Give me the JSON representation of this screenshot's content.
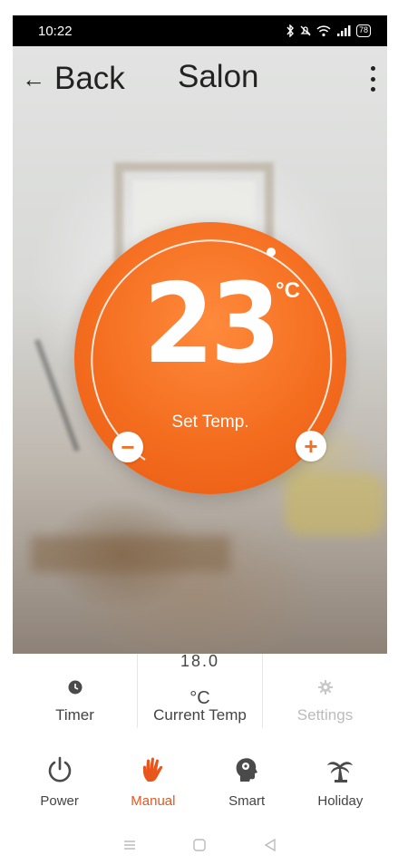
{
  "status_bar": {
    "time": "10:22",
    "battery": "78"
  },
  "header": {
    "back_label": "Back",
    "back_icon": "←",
    "title": "Salon",
    "more_icon": "more-vertical"
  },
  "thermostat": {
    "set_temp": "23",
    "unit": "°C",
    "label": "Set Temp.",
    "minus": "−",
    "plus": "+"
  },
  "info": {
    "timer_label": "Timer",
    "current_temp_value": "18.0",
    "current_temp_unit": "°C",
    "current_temp_label": "Current Temp",
    "settings_label": "Settings"
  },
  "modes": [
    {
      "label": "Power",
      "icon": "power-icon",
      "active": false
    },
    {
      "label": "Manual",
      "icon": "hand-icon",
      "active": true
    },
    {
      "label": "Smart",
      "icon": "brain-head-icon",
      "active": false
    },
    {
      "label": "Holiday",
      "icon": "palm-tree-icon",
      "active": false
    }
  ],
  "colors": {
    "accent": "#f46d1f",
    "active_label": "#e8561d"
  }
}
